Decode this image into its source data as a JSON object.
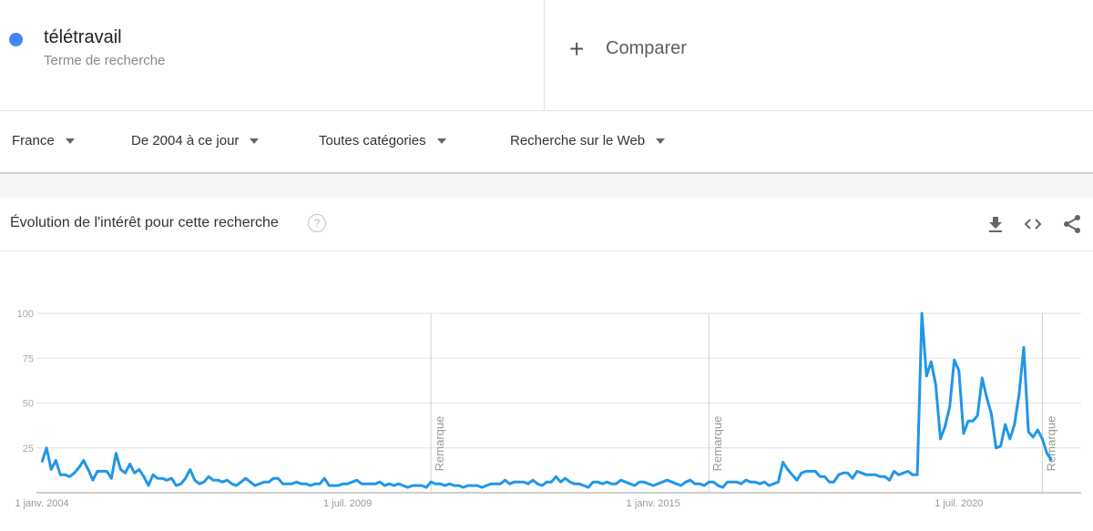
{
  "search_term": {
    "name": "télétravail",
    "subtitle": "Terme de recherche",
    "color": "#4285f4"
  },
  "compare": {
    "icon": "plus-icon",
    "label": "Comparer"
  },
  "filters": [
    {
      "label": "France"
    },
    {
      "label": "De 2004 à ce jour"
    },
    {
      "label": "Toutes catégories"
    },
    {
      "label": "Recherche sur le Web"
    }
  ],
  "card": {
    "title": "Évolution de l'intérêt pour cette recherche",
    "help_icon": "?",
    "actions": [
      "download-icon",
      "embed-icon",
      "share-icon"
    ]
  },
  "chart_data": {
    "type": "line",
    "title": "Évolution de l'intérêt pour cette recherche",
    "xlabel": "",
    "ylabel": "",
    "ylim": [
      0,
      100
    ],
    "yticks": [
      100,
      75,
      50,
      25
    ],
    "grid": true,
    "x_start": "2004-01",
    "x_interval": "month",
    "xtick_labels": [
      {
        "label": "1 janv. 2004",
        "month_index": 0
      },
      {
        "label": "1 juil. 2009",
        "month_index": 66
      },
      {
        "label": "1 janv. 2015",
        "month_index": 132
      },
      {
        "label": "1 juil. 2020",
        "month_index": 198
      }
    ],
    "annotations": [
      {
        "label": "Remarque",
        "month_index": 84
      },
      {
        "label": "Remarque",
        "month_index": 144
      },
      {
        "label": "Remarque",
        "month_index": 216
      }
    ],
    "series": [
      {
        "name": "télétravail",
        "color": "#2196e8",
        "values": [
          17,
          25,
          13,
          18,
          10,
          10,
          9,
          11,
          14,
          18,
          13,
          7,
          12,
          12,
          12,
          8,
          22,
          13,
          11,
          16,
          11,
          13,
          9,
          4,
          10,
          8,
          8,
          7,
          8,
          4,
          5,
          8,
          13,
          7,
          5,
          6,
          9,
          7,
          7,
          6,
          7,
          5,
          4,
          6,
          8,
          6,
          4,
          5,
          6,
          6,
          8,
          8,
          5,
          5,
          5,
          6,
          5,
          5,
          4,
          5,
          5,
          8,
          4,
          4,
          4,
          5,
          5,
          6,
          7,
          5,
          5,
          5,
          5,
          6,
          4,
          5,
          4,
          5,
          4,
          3,
          4,
          4,
          4,
          3,
          6,
          5,
          5,
          4,
          5,
          4,
          4,
          3,
          4,
          4,
          4,
          3,
          4,
          5,
          5,
          5,
          7,
          5,
          6,
          6,
          6,
          5,
          7,
          5,
          4,
          6,
          6,
          9,
          6,
          8,
          6,
          5,
          5,
          4,
          3,
          6,
          6,
          5,
          6,
          5,
          5,
          7,
          6,
          5,
          4,
          6,
          6,
          5,
          4,
          5,
          6,
          7,
          6,
          5,
          4,
          6,
          7,
          5,
          5,
          4,
          6,
          6,
          4,
          3,
          6,
          6,
          6,
          5,
          7,
          6,
          6,
          5,
          6,
          4,
          5,
          6,
          17,
          13,
          10,
          7,
          11,
          12,
          12,
          12,
          9,
          9,
          6,
          6,
          10,
          11,
          11,
          8,
          12,
          11,
          10,
          10,
          10,
          9,
          9,
          7,
          12,
          10,
          11,
          12,
          10,
          10,
          100,
          65,
          73,
          60,
          30,
          37,
          48,
          74,
          68,
          33,
          40,
          40,
          43,
          64,
          53,
          44,
          25,
          26,
          38,
          30,
          38,
          55,
          81,
          34,
          31,
          35,
          30,
          22,
          18
        ]
      }
    ]
  }
}
